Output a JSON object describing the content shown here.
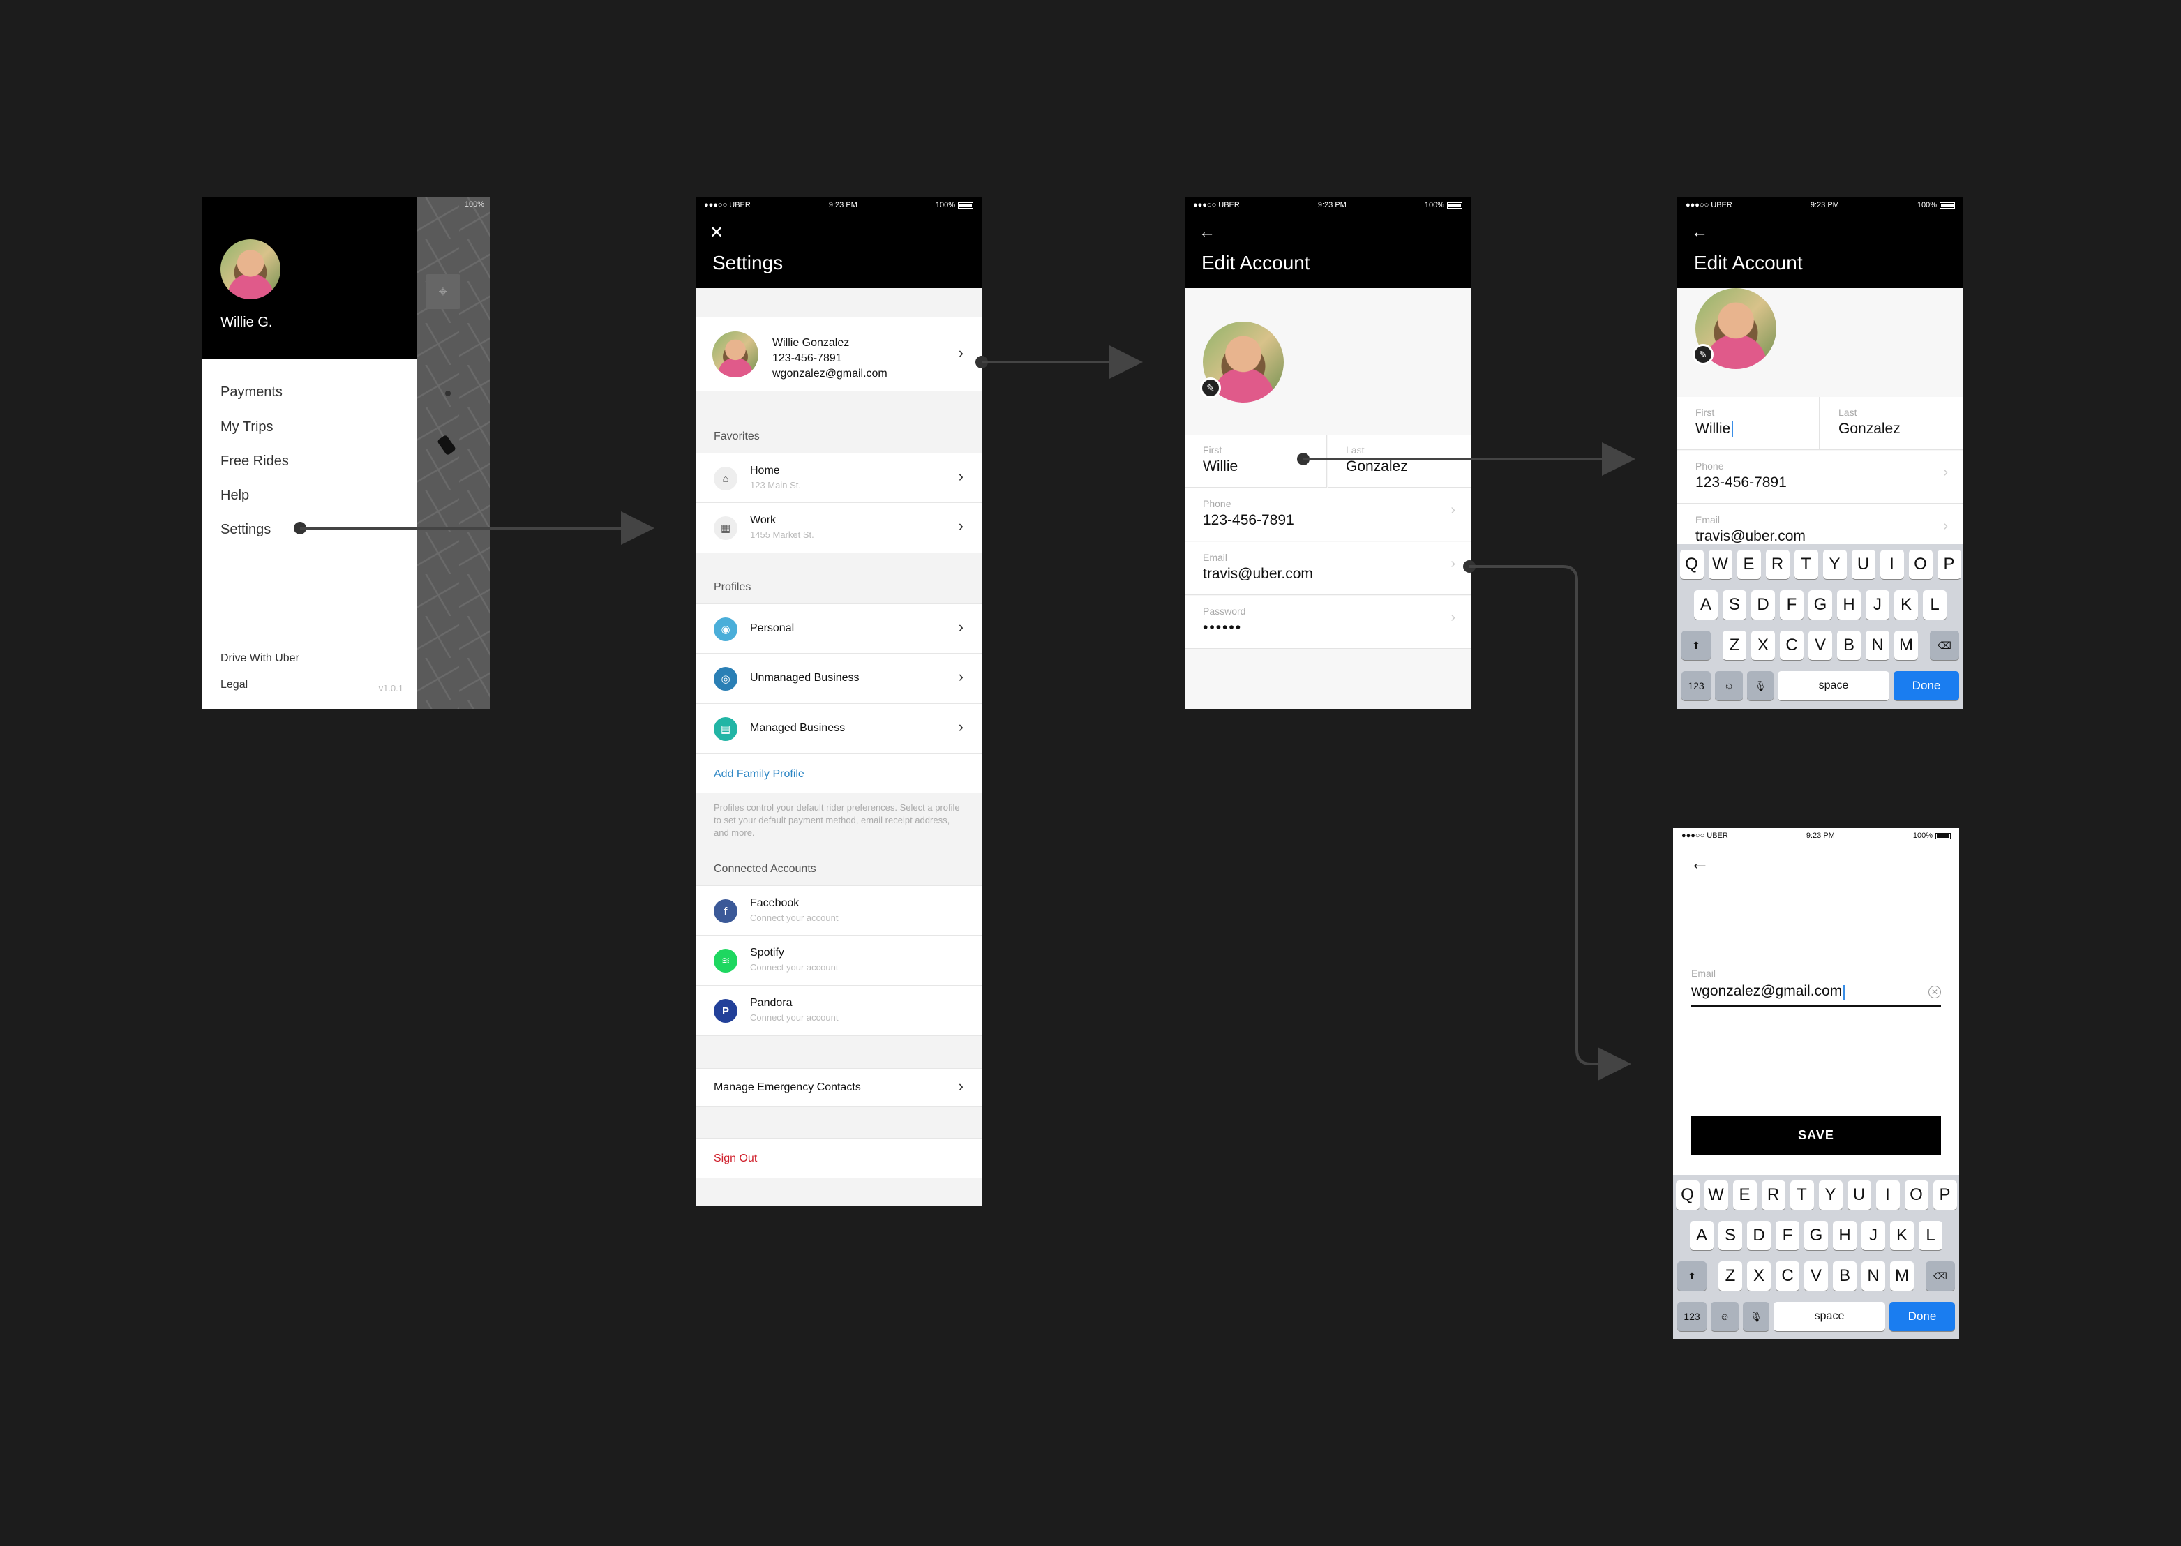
{
  "status": {
    "carrier": "●●●○○ UBER",
    "time": "9:23 PM",
    "battery": "100%"
  },
  "menu": {
    "user_name": "Willie G.",
    "items": [
      "Payments",
      "My Trips",
      "Free Rides",
      "Help",
      "Settings"
    ],
    "footer": [
      "Drive With Uber",
      "Legal"
    ],
    "version": "v1.0.1",
    "map_status": "100%"
  },
  "settings": {
    "title": "Settings",
    "close_icon": "✕",
    "profile": {
      "name": "Willie Gonzalez",
      "phone": "123-456-7891",
      "email": "wgonzalez@gmail.com"
    },
    "favorites_label": "Favorites",
    "favorites": [
      {
        "title": "Home",
        "sub": "123 Main St."
      },
      {
        "title": "Work",
        "sub": "1455 Market St."
      }
    ],
    "profiles_label": "Profiles",
    "profiles": [
      {
        "title": "Personal",
        "color": "#4aaed9"
      },
      {
        "title": "Unmanaged Business",
        "color": "#2a7fb5"
      },
      {
        "title": "Managed Business",
        "color": "#22b5a5"
      }
    ],
    "add_family": "Add Family Profile",
    "profiles_note": "Profiles control your default rider preferences. Select a profile to set your default payment method, email receipt address, and more.",
    "connected_label": "Connected Accounts",
    "connected": [
      {
        "title": "Facebook",
        "sub": "Connect your account",
        "color": "#3b5998",
        "glyph": "f"
      },
      {
        "title": "Spotify",
        "sub": "Connect your account",
        "color": "#1ed760",
        "glyph": "≋"
      },
      {
        "title": "Pandora",
        "sub": "Connect your account",
        "color": "#224099",
        "glyph": "P"
      }
    ],
    "emergency": "Manage Emergency Contacts",
    "sign_out": "Sign Out"
  },
  "edit_account": {
    "title": "Edit Account",
    "first_label": "First",
    "first_value": "Willie",
    "last_label": "Last",
    "last_value": "Gonzalez",
    "phone_label": "Phone",
    "phone_value": "123-456-7891",
    "email_label": "Email",
    "email_value": "travis@uber.com",
    "password_label": "Password",
    "password_value": "••••••"
  },
  "email_edit": {
    "label": "Email",
    "value": "wgonzalez@gmail.com",
    "save": "SAVE"
  },
  "keyboard": {
    "row1": [
      "Q",
      "W",
      "E",
      "R",
      "T",
      "Y",
      "U",
      "I",
      "O",
      "P"
    ],
    "row2": [
      "A",
      "S",
      "D",
      "F",
      "G",
      "H",
      "J",
      "K",
      "L"
    ],
    "row3": [
      "Z",
      "X",
      "C",
      "V",
      "B",
      "N",
      "M"
    ],
    "numbers": "123",
    "space": "space",
    "done": "Done"
  }
}
